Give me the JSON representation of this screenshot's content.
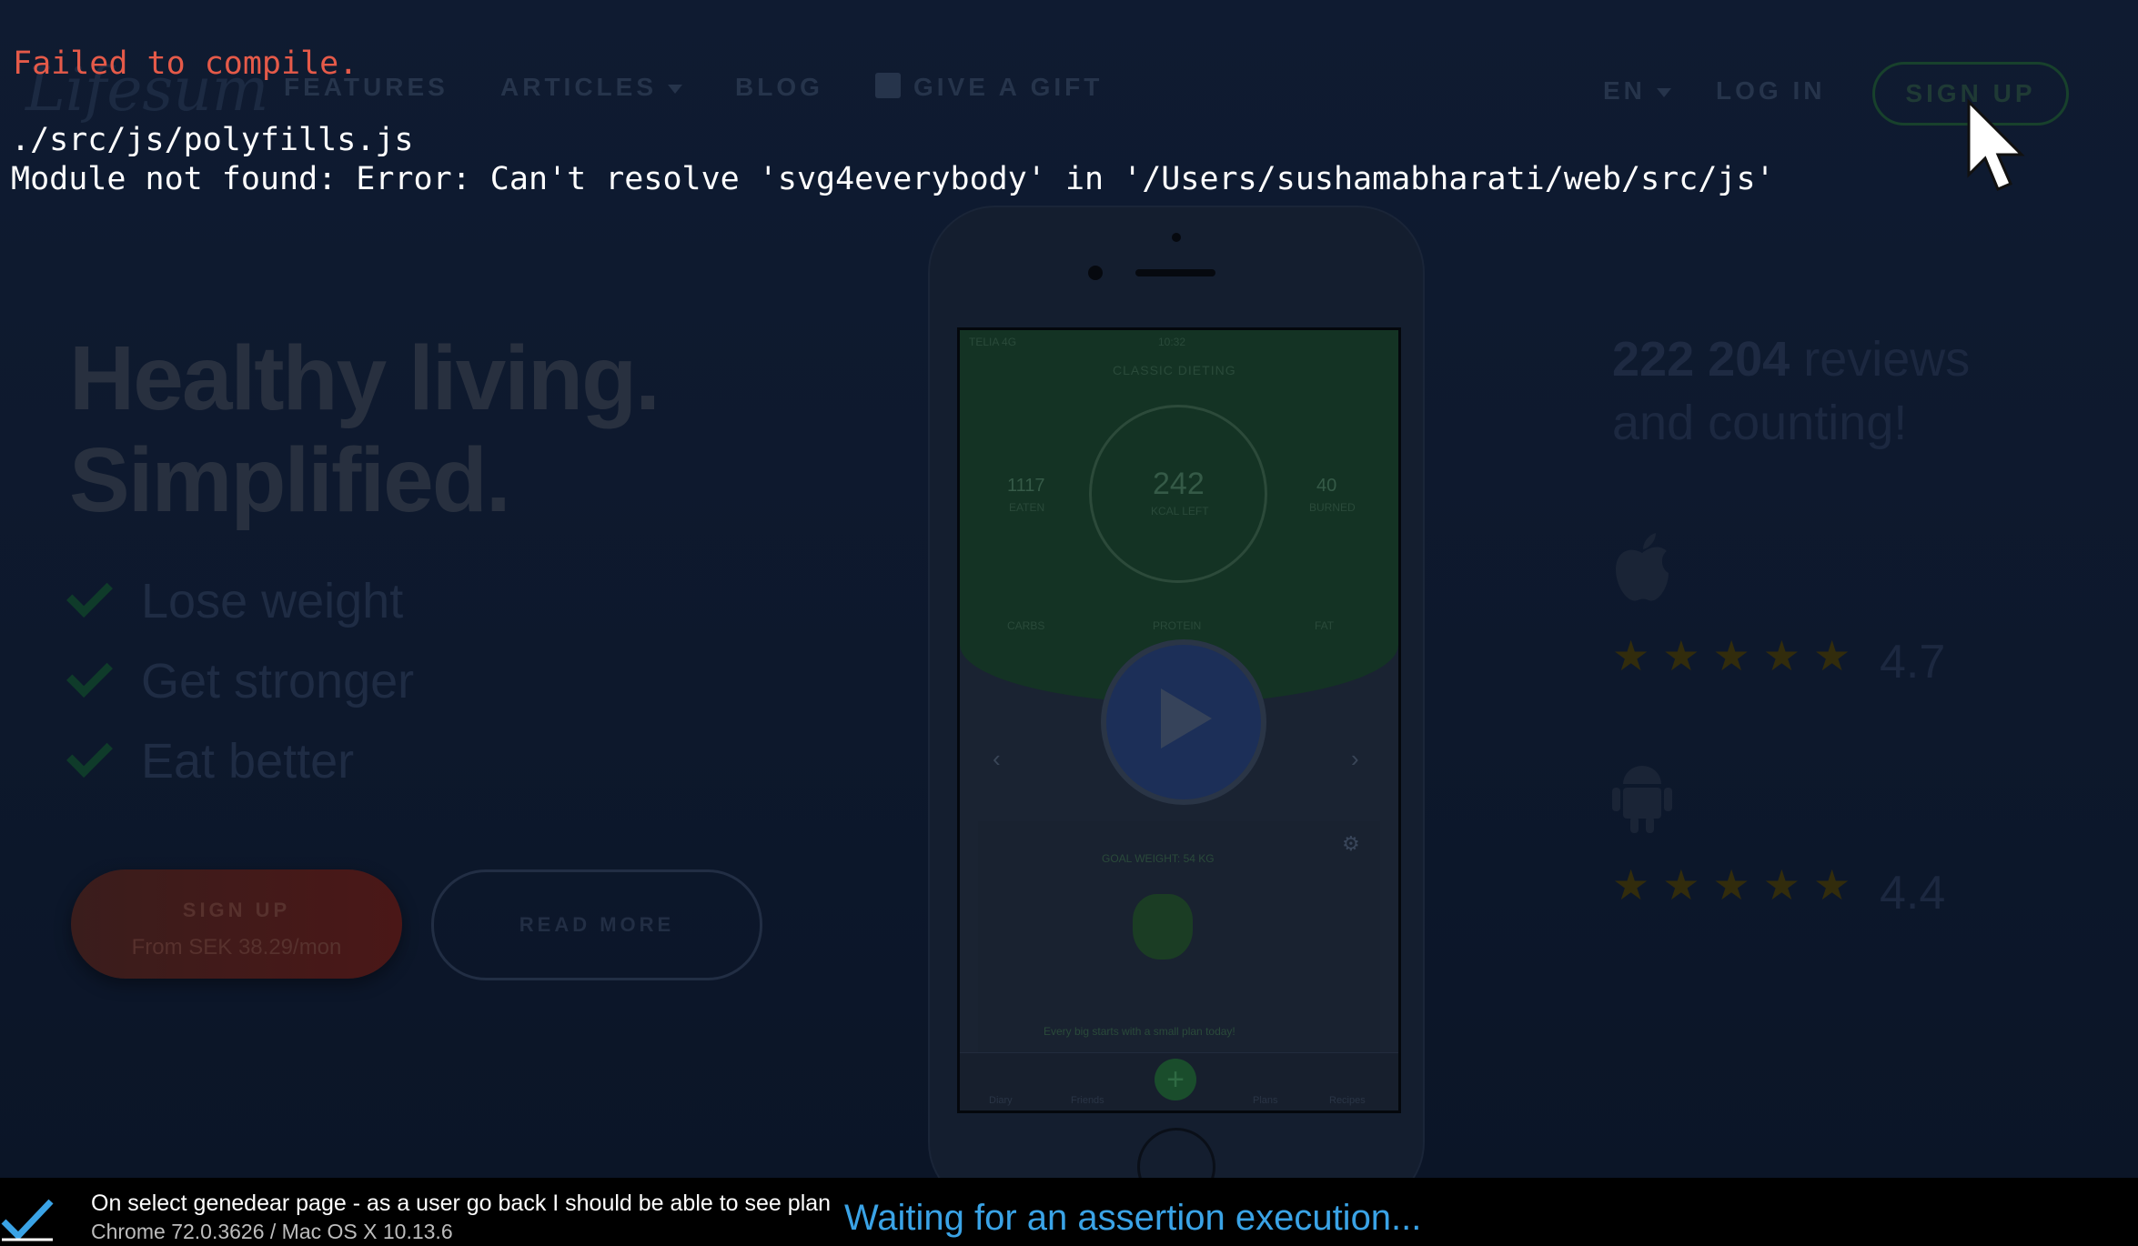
{
  "error": {
    "title": "Failed to compile.",
    "file": "./src/js/polyfills.js",
    "message": "Module not found: Error: Can't resolve 'svg4everybody' in '/Users/sushamabharati/web/src/js'"
  },
  "nav": {
    "logo": "Lifesum",
    "items": [
      "FEATURES",
      "ARTICLES",
      "BLOG",
      "GIVE A GIFT"
    ],
    "language": "EN",
    "login": "LOG IN",
    "signup": "SIGN UP"
  },
  "hero": {
    "line1": "Healthy living.",
    "line2": "Simplified.",
    "features": [
      "Lose weight",
      "Get stronger",
      "Eat better"
    ],
    "signup_label": "SIGN UP",
    "signup_price": "From SEK 38.29/mon",
    "read_more": "READ MORE"
  },
  "phone": {
    "carrier": "TELIA 4G",
    "time": "10:32",
    "header": "CLASSIC DIETING",
    "eaten_value": "1117",
    "eaten_label": "EATEN",
    "kcal_value": "242",
    "kcal_label": "KCAL LEFT",
    "burned_value": "40",
    "burned_label": "BURNED",
    "carbs": "CARBS",
    "protein": "PROTEIN",
    "fat": "FAT",
    "goal": "GOAL WEIGHT: 54 KG",
    "caption": "Every big starts with a small plan today!",
    "tabs": [
      "Diary",
      "Friends",
      "Plans",
      "Recipes"
    ]
  },
  "reviews": {
    "count": "222 204",
    "text_suffix": "reviews",
    "text_line2": "and counting!",
    "ios_stars": "★★★★★",
    "ios_rating": "4.7",
    "android_stars": "★★★★★",
    "android_rating": "4.4"
  },
  "status_bar": {
    "test_title": "On select genedear page - as a user go back I should be able to see plan",
    "browser": "Chrome 72.0.3626 / Mac OS X 10.13.6",
    "waiting": "Waiting for an assertion execution..."
  },
  "colors": {
    "error_red": "#e55a49",
    "waiting_blue": "#3aa3e6",
    "background": "#0f1b31"
  },
  "icons": [
    "gift-icon",
    "caret-down-icon",
    "cursor-icon",
    "play-icon",
    "apple-icon",
    "android-icon",
    "star-icon",
    "checkmark-icon",
    "gear-icon",
    "plus-icon"
  ]
}
